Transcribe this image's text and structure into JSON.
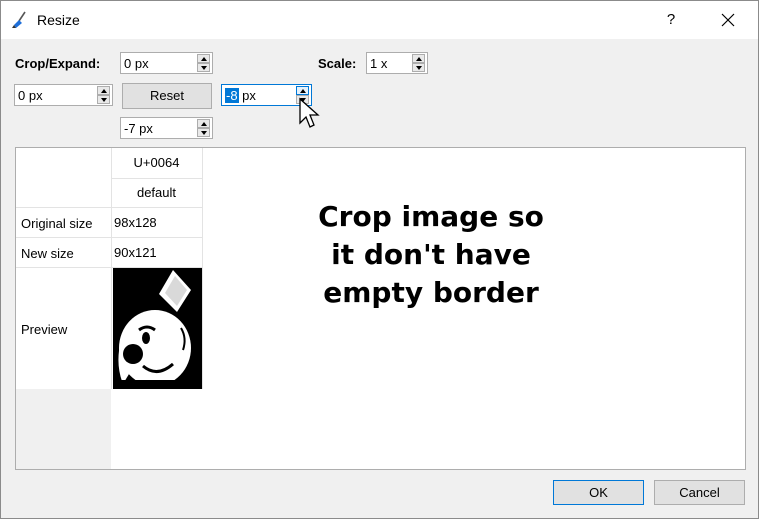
{
  "window": {
    "title": "Resize",
    "help_label": "?",
    "close_icon": "close-icon"
  },
  "crop": {
    "label": "Crop/Expand:",
    "top_value": "0 px",
    "left_value": "0 px",
    "right_value_selected": "-8",
    "right_value_unit": " px",
    "bottom_value": "-7 px",
    "reset_label": "Reset"
  },
  "scale": {
    "label": "Scale:",
    "value": "1 x"
  },
  "table": {
    "codepoint": "U+0064",
    "style": "default",
    "original_size_label": "Original size",
    "original_size_value": "98x128",
    "new_size_label": "New size",
    "new_size_value": "90x121",
    "preview_label": "Preview"
  },
  "annotation": {
    "line1": "Crop image so",
    "line2": "it don't have",
    "line3": "empty border"
  },
  "footer": {
    "ok_label": "OK",
    "cancel_label": "Cancel"
  },
  "colors": {
    "accent": "#0078d7",
    "background": "#f0f0f0"
  }
}
